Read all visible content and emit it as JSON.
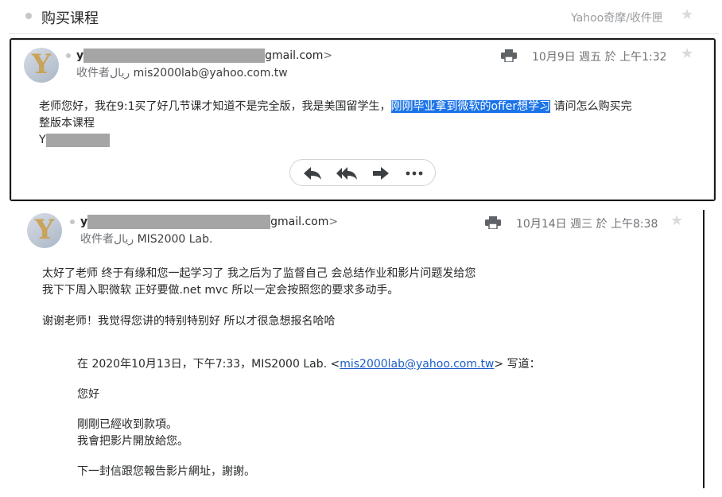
{
  "header": {
    "subject": "购买课程",
    "folder": "Yahoo奇摩/收件匣"
  },
  "messages": [
    {
      "sender_prefix": "y",
      "sender_suffix": "gmail.com",
      "sender_chevron": ">",
      "to_label": "收件者",
      "to_name_label": "ريال",
      "to": "mis2000lab@yahoo.com.tw",
      "date": "10月9日 週五 於 上午1:32",
      "body_line1_a": "老师您好，我在9:1买了好几节课才知道不是完全版，我是美国留学生，",
      "body_line1_highlight": "刚刚毕业拿到微软的offer想学习",
      "body_line1_b": " 请问怎么购买完",
      "body_line2": "整版本课程",
      "signature_initial": "Y"
    },
    {
      "sender_prefix": "y",
      "sender_suffix": "gmail.com",
      "sender_chevron": ">",
      "to_label": "收件者",
      "to_name_label": "ريال",
      "to": "MIS2000 Lab.",
      "date": "10月14日 週三 於 上午8:38",
      "body_lines": [
        "太好了老师 终于有缘和您一起学习了 我之后为了监督自己 会总结作业和影片问题发给您",
        "我下下周入职微软 正好要做.net mvc 所以一定会按照您的要求多动手。",
        "谢谢老师！我觉得您讲的特别特别好 所以才很急想报名哈哈"
      ],
      "quote_header_a": "在 2020年10月13日，下午7:33，MIS2000 Lab. <",
      "quote_link": "mis2000lab@yahoo.com.tw",
      "quote_header_b": "> 写道：",
      "quote_lines": [
        "您好",
        "剛剛已經收到款項。",
        "我會把影片開放給您。",
        "下一封信跟您報告影片網址，謝謝。"
      ]
    }
  ],
  "icons": {
    "star": "star-icon",
    "print": "print-icon",
    "reply": "reply-icon",
    "reply_all": "reply-all-icon",
    "forward": "forward-icon",
    "more": "more-icon"
  }
}
